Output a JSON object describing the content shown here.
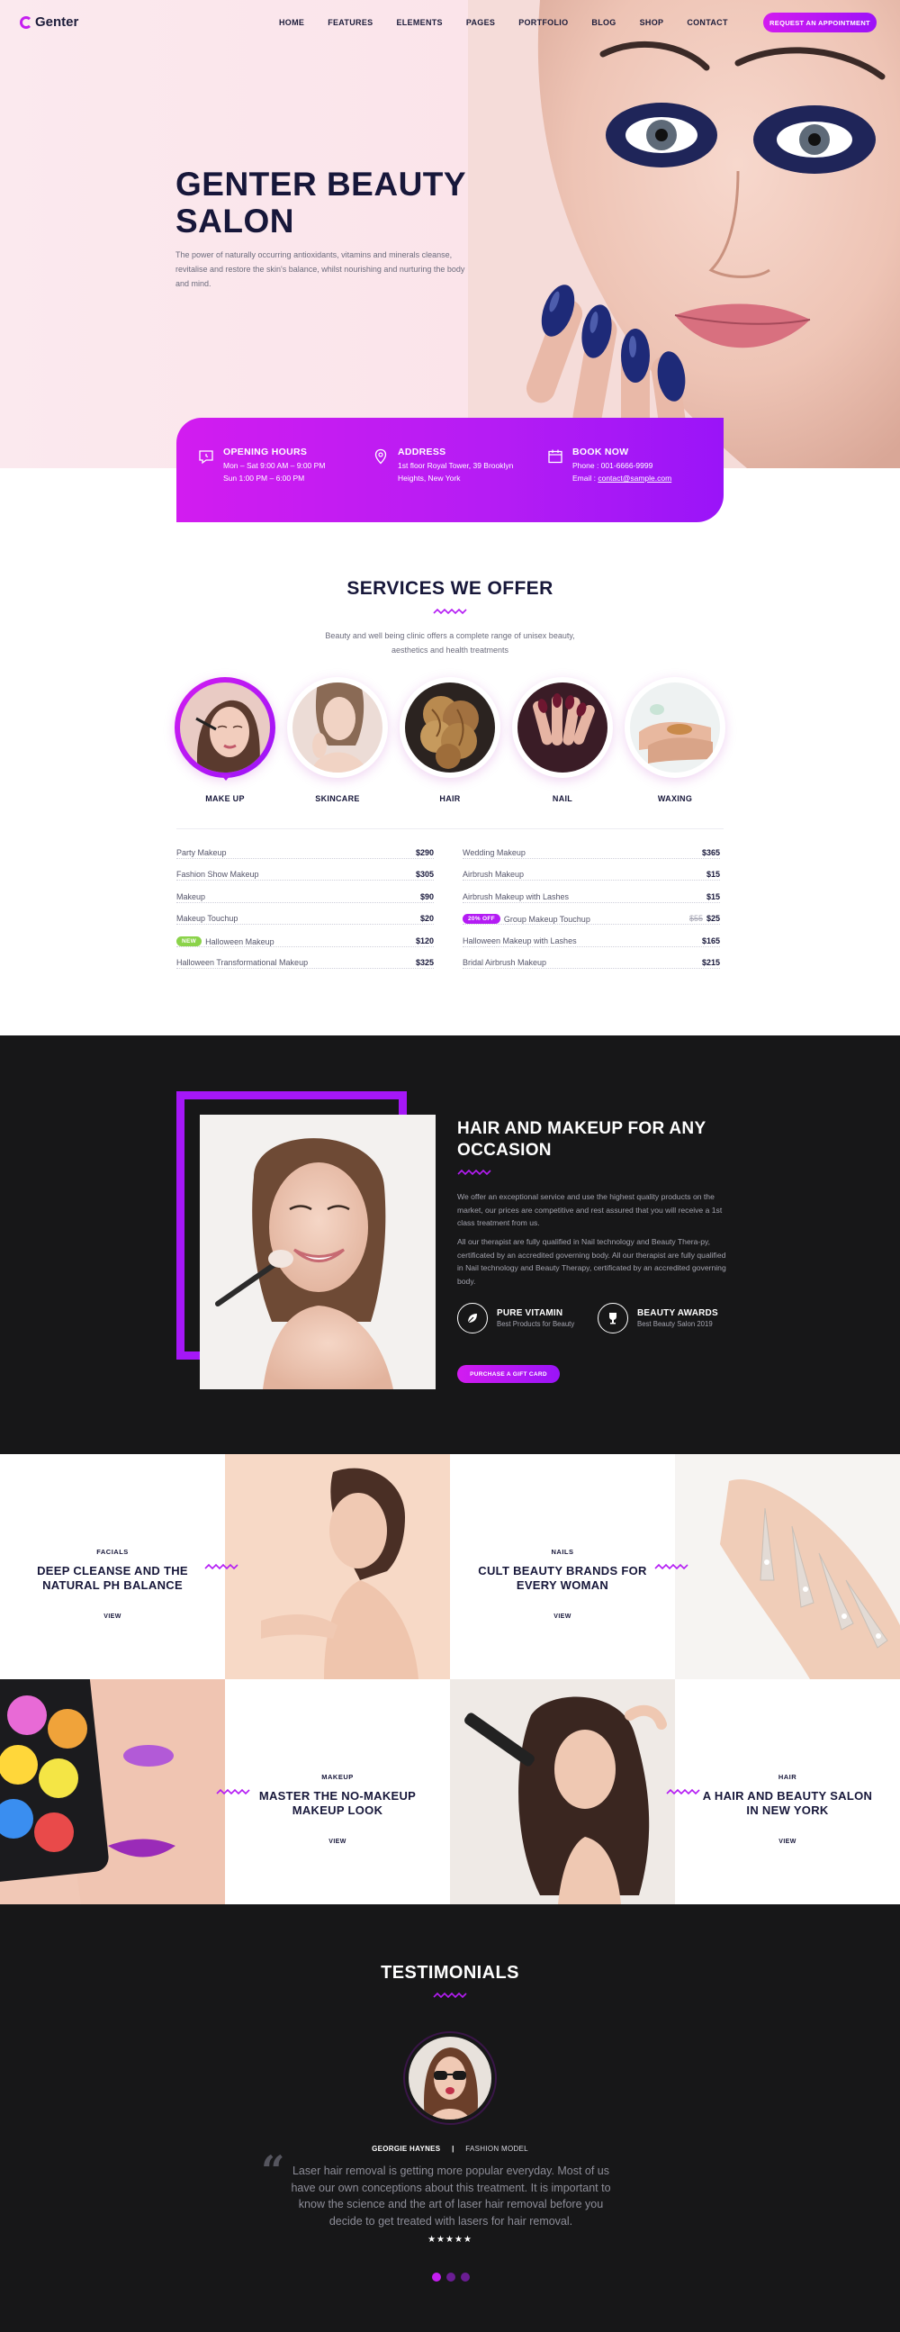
{
  "brand": {
    "name": "Genter",
    "accent": "#c51ef0",
    "accent2": "#9a14f8",
    "dark": "#171718"
  },
  "nav": {
    "items": [
      "HOME",
      "FEATURES",
      "ELEMENTS",
      "PAGES",
      "PORTFOLIO",
      "BLOG",
      "SHOP",
      "CONTACT"
    ],
    "cta": "REQUEST AN APPOINTMENT"
  },
  "hero": {
    "title": "GENTER BEAUTY SALON",
    "text": "The power of naturally occurring antioxidants, vitamins and minerals cleanse, revitalise and restore the skin's balance, whilst nourishing and nurturing the body and mind."
  },
  "info": {
    "hours": {
      "title": "OPENING HOURS",
      "line1": "Mon – Sat     9:00 AM – 9:00 PM",
      "line2": "Sun               1:00 PM – 6:00 PM"
    },
    "address": {
      "title": "ADDRESS",
      "line1": "1st floor Royal Tower, 39 Brooklyn",
      "line2": "Heights, New York"
    },
    "book": {
      "title": "BOOK NOW",
      "line1": "Phone : 001-6666-9999",
      "email_label": "Email : ",
      "email": "contact@sample.com"
    }
  },
  "services": {
    "title": "SERVICES WE OFFER",
    "subtitle": "Beauty and well being clinic offers a complete range of unisex beauty, aesthetics and health treatments",
    "tabs": [
      "MAKE UP",
      "SKINCARE",
      "HAIR",
      "NAIL",
      "WAXING"
    ],
    "prices_left": [
      {
        "name": "Party Makeup",
        "price": "$290"
      },
      {
        "name": "Fashion Show Makeup",
        "price": "$305"
      },
      {
        "name": "Makeup",
        "price": "$90"
      },
      {
        "name": "Makeup Touchup",
        "price": "$20"
      },
      {
        "name": "Halloween Makeup",
        "price": "$120",
        "tag": "NEW"
      },
      {
        "name": "Halloween Transformational Makeup",
        "price": "$325"
      }
    ],
    "prices_right": [
      {
        "name": "Wedding Makeup",
        "price": "$365"
      },
      {
        "name": "Airbrush Makeup",
        "price": "$15"
      },
      {
        "name": "Airbrush Makeup with Lashes",
        "price": "$15"
      },
      {
        "name": "Group Makeup Touchup",
        "price": "$25",
        "old": "$55",
        "tag": "20% OFF"
      },
      {
        "name": "Halloween Makeup with Lashes",
        "price": "$165"
      },
      {
        "name": "Bridal Airbrush Makeup",
        "price": "$215"
      }
    ]
  },
  "about": {
    "title": "HAIR AND MAKEUP FOR ANY OCCASION",
    "p1": "We offer an exceptional service and use the highest quality products on the market, our prices are competitive and rest assured that you will receive a 1st class treatment from us.",
    "p2": "All our therapist are fully qualified in Nail technology and Beauty Thera-py, certificated by an accredited governing body. All our therapist are fully qualified in Nail technology and Beauty Therapy, certificated by an accredited governing body.",
    "feature1": {
      "title": "PURE VITAMIN",
      "sub": "Best Products for Beauty"
    },
    "feature2": {
      "title": "BEAUTY AWARDS",
      "sub": "Best Beauty Salon 2019"
    },
    "button": "PURCHASE A GIFT CARD"
  },
  "tiles": [
    {
      "category": "FACIALS",
      "title": "DEEP CLEANSE AND THE NATURAL PH BALANCE",
      "view": "VIEW"
    },
    {
      "category": "NAILS",
      "title": "CULT BEAUTY BRANDS FOR EVERY WOMAN",
      "view": "VIEW"
    },
    {
      "category": "MAKEUP",
      "title": "MASTER THE NO-MAKEUP MAKEUP LOOK",
      "view": "VIEW"
    },
    {
      "category": "HAIR",
      "title": "A HAIR AND BEAUTY SALON IN NEW YORK",
      "view": "VIEW"
    }
  ],
  "testimonials": {
    "title": "TESTIMONIALS",
    "name": "GEORGIE HAYNES",
    "separator": "|",
    "role": "FASHION MODEL",
    "quote": "Laser hair removal is getting more popular everyday. Most of us have our own conceptions about this treatment. It is important to know the science and the art of laser hair removal before you decide to get treated with lasers for hair removal.",
    "stars": "★★★★★"
  }
}
